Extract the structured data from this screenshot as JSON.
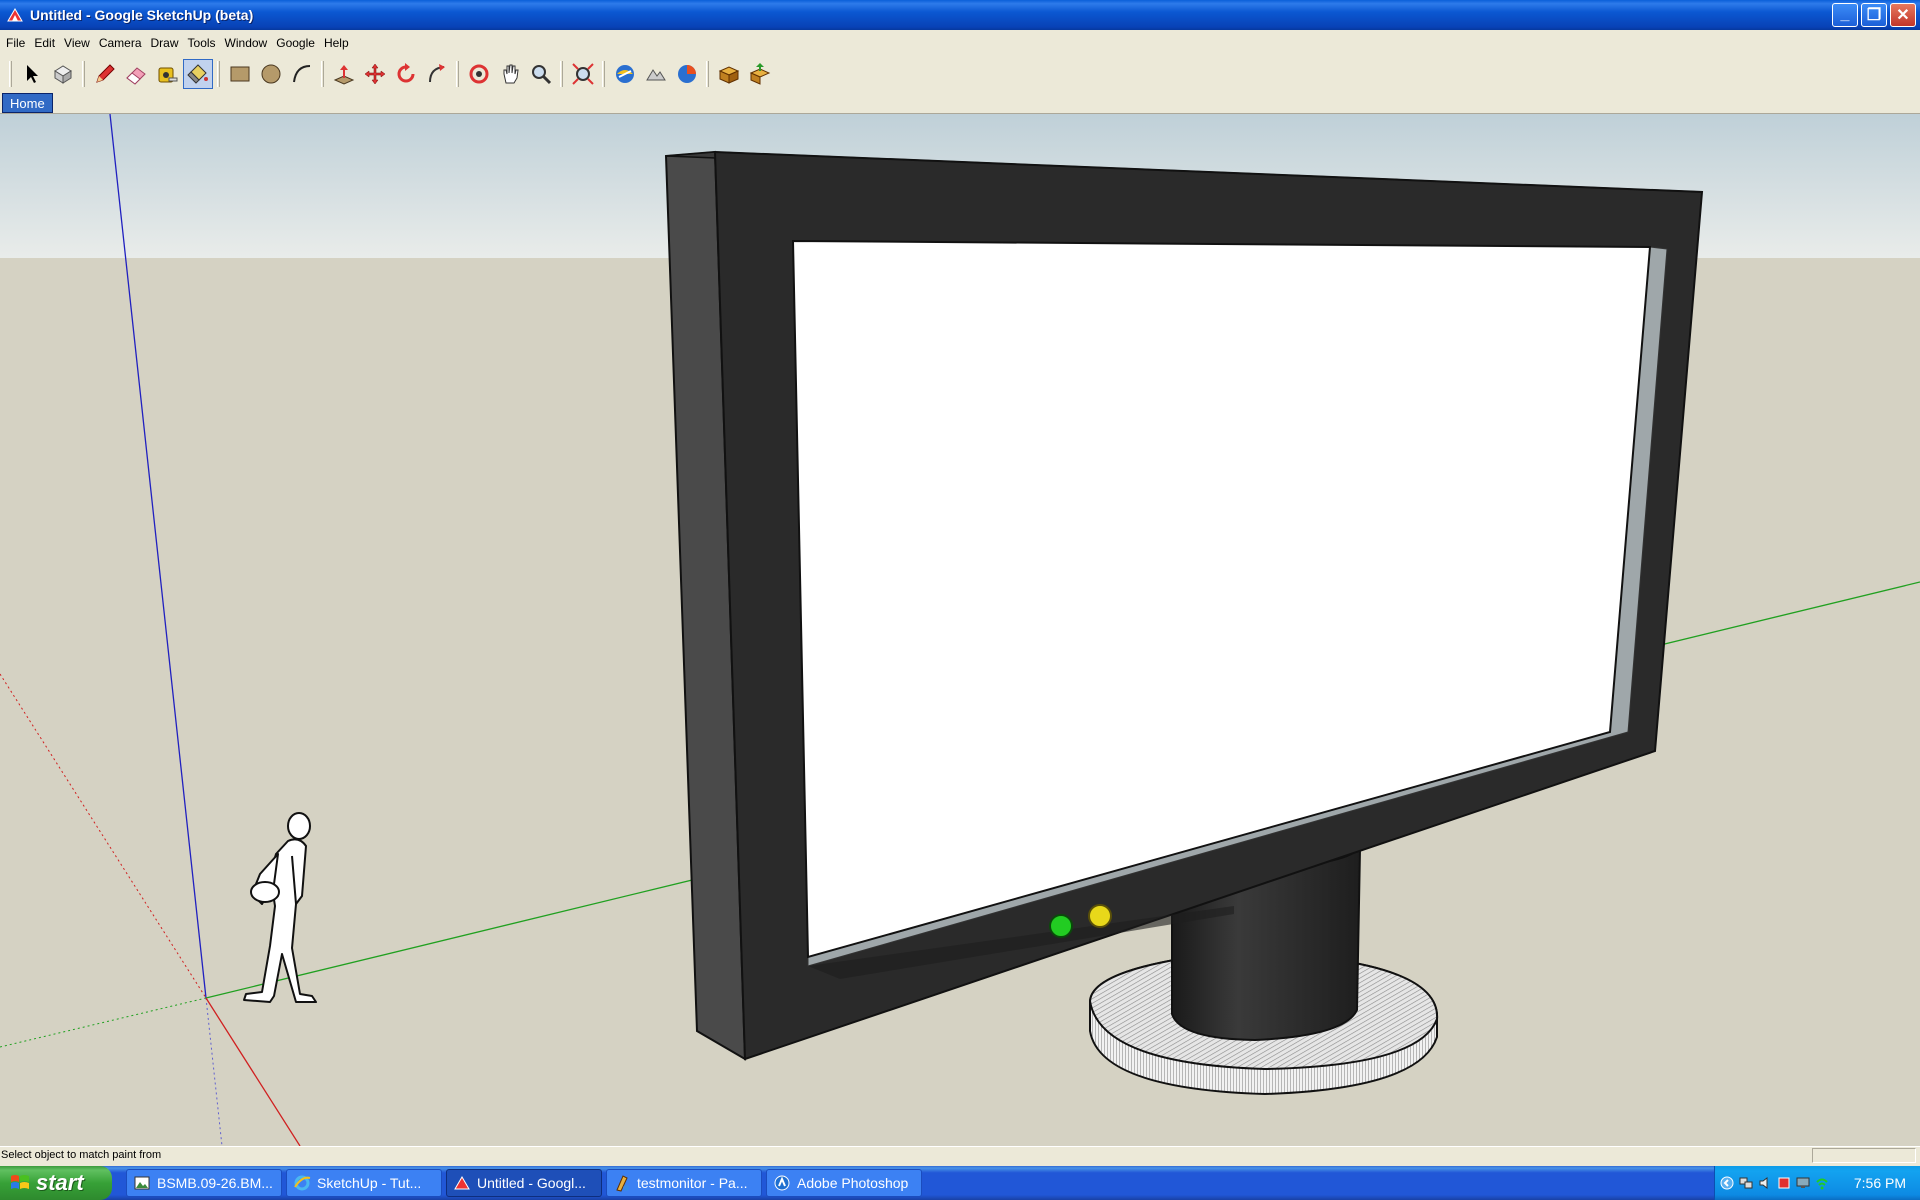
{
  "window": {
    "title": "Untitled - Google SketchUp (beta)",
    "buttons": [
      "minimize",
      "restore",
      "close"
    ]
  },
  "menubar": {
    "items": [
      "File",
      "Edit",
      "View",
      "Camera",
      "Draw",
      "Tools",
      "Window",
      "Google",
      "Help"
    ]
  },
  "toolbar": {
    "tools": [
      {
        "name": "select-icon"
      },
      {
        "name": "make-component-icon"
      },
      {
        "name": "pencil-icon"
      },
      {
        "name": "eraser-icon"
      },
      {
        "name": "tape-measure-icon"
      },
      {
        "name": "paint-bucket-icon",
        "active": true
      },
      {
        "name": "rectangle-icon"
      },
      {
        "name": "circle-icon"
      },
      {
        "name": "arc-icon"
      },
      {
        "name": "push-pull-icon"
      },
      {
        "name": "move-icon"
      },
      {
        "name": "rotate-icon"
      },
      {
        "name": "follow-me-icon"
      },
      {
        "name": "orbit-icon"
      },
      {
        "name": "pan-icon"
      },
      {
        "name": "zoom-icon"
      },
      {
        "name": "zoom-extents-icon"
      },
      {
        "name": "get-current-view-icon"
      },
      {
        "name": "toggle-terrain-icon"
      },
      {
        "name": "place-model-icon"
      },
      {
        "name": "get-models-icon"
      },
      {
        "name": "share-model-icon"
      }
    ]
  },
  "scenes": {
    "tabs": [
      "Home"
    ]
  },
  "statusbar": {
    "text": "Select object to match paint from"
  },
  "taskbar": {
    "start_label": "start",
    "tasks": [
      {
        "label": "BSMB.09-26.BM...",
        "icon": "image-file-icon"
      },
      {
        "label": "SketchUp - Tut...",
        "icon": "internet-explorer-icon"
      },
      {
        "label": "Untitled - Googl...",
        "icon": "sketchup-icon",
        "active": true
      },
      {
        "label": "testmonitor - Pa...",
        "icon": "paint-icon"
      },
      {
        "label": "Adobe Photoshop",
        "icon": "photoshop-icon"
      }
    ],
    "clock": "7:56 PM"
  },
  "colors": {
    "sky_top": "#C9D6DC",
    "ground": "#D5D2C3",
    "monitor_frame": "#2A2A2A",
    "screen": "#FFFFFF",
    "led_green": "#22CC22",
    "led_yellow": "#E8D81A"
  }
}
